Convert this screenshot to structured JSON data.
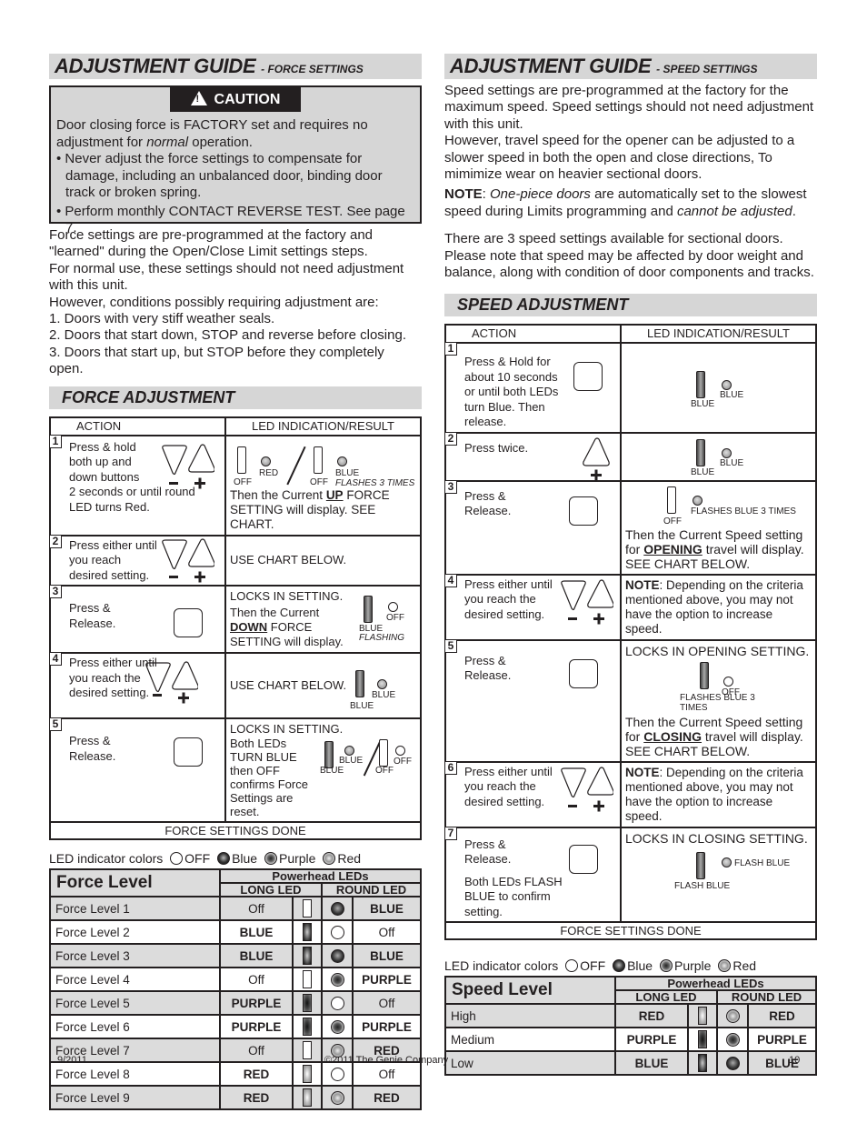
{
  "force": {
    "title": "ADJUSTMENT GUIDE",
    "subtitle": "- FORCE SETTINGS",
    "caution": {
      "label": "CAUTION",
      "line1a": "Door closing force is FACTORY set and requires no adjustment for ",
      "line1_italic": "normal",
      "line1b": " operation.",
      "bullets": [
        "• Never adjust the force settings to compensate for damage, including an unbalanced door, binding door track or broken spring.",
        "• Perform monthly CONTACT REVERSE TEST. See page 7."
      ]
    },
    "intro": [
      "Force settings are pre-programmed at the factory and \"learned\" during the Open/Close Limit settings steps.",
      "For normal use, these settings should not need adjustment with this unit.",
      "However, conditions possibly requiring adjustment are:",
      "1. Doors with very stiff weather seals.",
      "2. Doors that start down, STOP and reverse before closing.",
      "3. Doors that start up, but STOP before they completely open."
    ],
    "section_title": "FORCE ADJUSTMENT",
    "table_headers": {
      "action": "ACTION",
      "result": "LED INDICATION/RESULT"
    },
    "steps": [
      {
        "num": "1",
        "action": "Press & hold both up and down buttons",
        "action_extra": "2 seconds or until round LED turns Red.",
        "led_labels": [
          "OFF",
          "RED",
          "OFF",
          "BLUE",
          "FLASHES 3 TIMES"
        ],
        "result_a": "Then the Current ",
        "result_u": "UP",
        "result_b": " FORCE SETTING will display. SEE CHART."
      },
      {
        "num": "2",
        "action": "Press either until you reach desired setting.",
        "result": "USE CHART BELOW."
      },
      {
        "num": "3",
        "action": "Press & Release.",
        "result_head": "LOCKS IN SETTING.",
        "result_a": "Then the Current ",
        "result_u": "DOWN",
        "result_b": " FORCE SETTING will display.",
        "led_labels": [
          "BLUE",
          "FLASHING",
          "OFF"
        ]
      },
      {
        "num": "4",
        "action": "Press either until you reach the desired setting.",
        "result": "USE CHART BELOW.",
        "led_labels": [
          "BLUE",
          "BLUE"
        ]
      },
      {
        "num": "5",
        "action": "Press & Release.",
        "result_head": "LOCKS IN SETTING.",
        "result": "Both LEDs TURN BLUE then OFF confirms Force Settings are reset.",
        "led_labels": [
          "BLUE",
          "BLUE",
          "OFF",
          "OFF"
        ]
      }
    ],
    "done": "FORCE SETTINGS DONE",
    "legend": {
      "label": "LED indicator colors",
      "off": "OFF",
      "blue": "Blue",
      "purple": "Purple",
      "red": "Red"
    },
    "chart": {
      "title": "Force Level",
      "powerhead": "Powerhead LEDs",
      "long_led": "LONG LED",
      "round_led": "ROUND LED",
      "rows": [
        {
          "name": "Force Level 1",
          "long": "Off",
          "long_state": "off",
          "round_state": "blue",
          "round": "BLUE"
        },
        {
          "name": "Force Level 2",
          "long": "BLUE",
          "long_state": "blue",
          "round_state": "off",
          "round": "Off"
        },
        {
          "name": "Force Level 3",
          "long": "BLUE",
          "long_state": "blue",
          "round_state": "blue",
          "round": "BLUE"
        },
        {
          "name": "Force Level 4",
          "long": "Off",
          "long_state": "off",
          "round_state": "purple",
          "round": "PURPLE"
        },
        {
          "name": "Force Level 5",
          "long": "PURPLE",
          "long_state": "purple",
          "round_state": "off",
          "round": "Off"
        },
        {
          "name": "Force Level 6",
          "long": "PURPLE",
          "long_state": "purple",
          "round_state": "purple",
          "round": "PURPLE"
        },
        {
          "name": "Force Level 7",
          "long": "Off",
          "long_state": "off",
          "round_state": "red",
          "round": "RED"
        },
        {
          "name": "Force Level 8",
          "long": "RED",
          "long_state": "red",
          "round_state": "off",
          "round": "Off"
        },
        {
          "name": "Force Level 9",
          "long": "RED",
          "long_state": "red",
          "round_state": "red",
          "round": "RED"
        }
      ]
    }
  },
  "speed": {
    "title": "ADJUSTMENT GUIDE",
    "subtitle": "- SPEED SETTINGS",
    "intro": [
      "Speed settings are pre-programmed at the factory for the maximum speed. Speed settings should not need adjustment with this unit.",
      "However, travel speed for the opener can be adjusted to a slower speed in both the open and close directions, To mimimize wear on heavier sectional doors."
    ],
    "note": {
      "label": "NOTE",
      "italic1": "One-piece doors",
      "text1": " are automatically set to the slowest speed during Limits programming and ",
      "italic2": "cannot be adjusted",
      "text2": "."
    },
    "intro2": "There are 3 speed settings available for sectional doors. Please note that speed may be affected by door weight and balance, along with condition of door components and tracks.",
    "section_title": "SPEED ADJUSTMENT",
    "table_headers": {
      "action": "ACTION",
      "result": "LED INDICATION/RESULT"
    },
    "steps": [
      {
        "num": "1",
        "action": "Press & Hold for about 10 seconds or until both LEDs turn Blue. Then release.",
        "led_labels": [
          "BLUE",
          "BLUE"
        ]
      },
      {
        "num": "2",
        "action": "Press twice.",
        "led_labels": [
          "BLUE",
          "BLUE"
        ]
      },
      {
        "num": "3",
        "action": "Press & Release.",
        "led_labels": [
          "OFF",
          "FLASHES BLUE 3 TIMES"
        ],
        "result_a": "Then the Current Speed setting for ",
        "result_u": "OPENING",
        "result_b": " travel will display. SEE CHART BELOW."
      },
      {
        "num": "4",
        "action": "Press either until you reach the desired setting.",
        "note_label": "NOTE",
        "note_text": ": Depending on the criteria mentioned above, you may not have the option to increase speed."
      },
      {
        "num": "5",
        "action": "Press & Release.",
        "result_head": "LOCKS IN OPENING SETTING.",
        "led_labels": [
          "OFF",
          "FLASHES BLUE 3 TIMES"
        ],
        "result_a": "Then the Current Speed setting for ",
        "result_u": "CLOSING",
        "result_b": " travel will display. SEE CHART BELOW."
      },
      {
        "num": "6",
        "action": "Press either until you reach the desired setting.",
        "note_label": "NOTE",
        "note_text": ": Depending on the criteria mentioned above, you may not have the option to increase speed."
      },
      {
        "num": "7",
        "action": "Press & Release.",
        "action_extra": "Both LEDs FLASH BLUE to confirm setting.",
        "result_head": "LOCKS IN CLOSING SETTING.",
        "led_labels": [
          "FLASH BLUE",
          "FLASH BLUE"
        ]
      }
    ],
    "done": "FORCE SETTINGS DONE",
    "legend": {
      "label": "LED indicator colors",
      "off": "OFF",
      "blue": "Blue",
      "purple": "Purple",
      "red": "Red"
    },
    "chart": {
      "title": "Speed Level",
      "powerhead": "Powerhead LEDs",
      "long_led": "LONG LED",
      "round_led": "ROUND LED",
      "rows": [
        {
          "name": "High",
          "long": "RED",
          "long_state": "red",
          "round_state": "red",
          "round": "RED"
        },
        {
          "name": "Medium",
          "long": "PURPLE",
          "long_state": "purple",
          "round_state": "purple",
          "round": "PURPLE"
        },
        {
          "name": "Low",
          "long": "BLUE",
          "long_state": "blue",
          "round_state": "blue",
          "round": "BLUE"
        }
      ]
    }
  },
  "footer": {
    "date": "9/2011",
    "copyright": "©2011 The Genie Company",
    "page": "10"
  }
}
